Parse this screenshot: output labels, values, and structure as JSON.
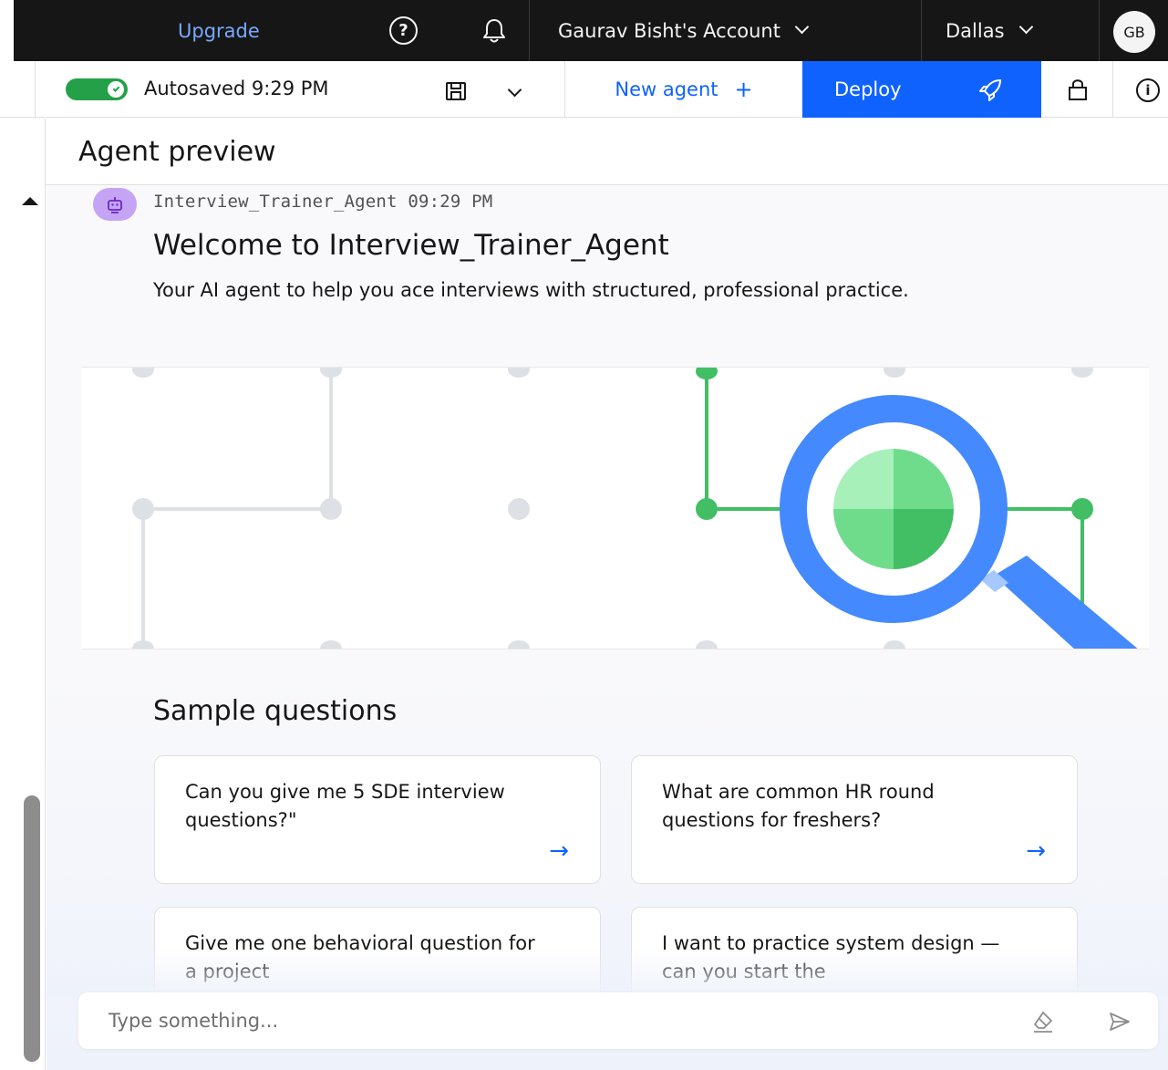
{
  "topbar": {
    "upgrade": "Upgrade",
    "account": "Gaurav Bisht's Account",
    "region": "Dallas",
    "avatar_initials": "GB"
  },
  "toolbar": {
    "autosaved": "Autosaved 9:29 PM",
    "new_agent": "New agent",
    "new_agent_icon": "+",
    "deploy": "Deploy"
  },
  "header": {
    "title": "Agent preview"
  },
  "chat": {
    "sender_meta": "Interview_Trainer_Agent 09:29 PM",
    "welcome_title": "Welcome to Interview_Trainer_Agent",
    "welcome_desc": "Your AI agent to help you ace interviews with structured, professional practice.",
    "sample_title": "Sample questions",
    "questions": [
      "Can you give me 5 SDE interview questions?\"",
      "What are common HR round questions for freshers?",
      "Give me one behavioral question for a project",
      "I want to practice system design — can you start the"
    ],
    "arrow_glyph": "→"
  },
  "input": {
    "placeholder": "Type something..."
  },
  "colors": {
    "accent": "#0f62fe",
    "topbar_bg": "#161616",
    "toggle_on": "#24a148",
    "bot_avatar": "#c6a4f5",
    "illustration_green": "#42be65",
    "illustration_blue": "#4589ff"
  },
  "icons": {
    "help": "help-icon",
    "notifications": "bell-icon",
    "save": "save-icon",
    "deploy": "rocket-icon",
    "lock": "lock-icon",
    "info": "info-icon",
    "clear": "eraser-icon",
    "send": "send-icon"
  }
}
